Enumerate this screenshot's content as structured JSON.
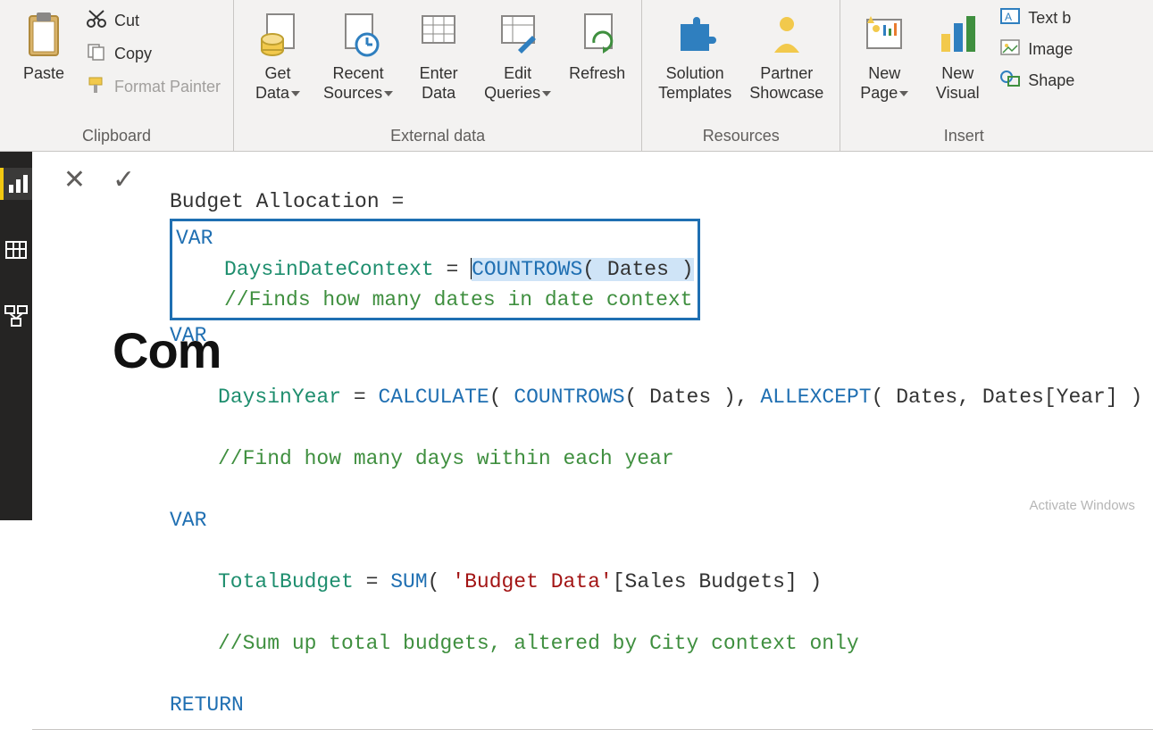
{
  "ribbon": {
    "clipboard": {
      "label": "Clipboard",
      "paste": "Paste",
      "cut": "Cut",
      "copy": "Copy",
      "format_painter": "Format Painter"
    },
    "external": {
      "label": "External data",
      "get_data": "Get\nData",
      "recent_sources": "Recent\nSources",
      "enter_data": "Enter\nData",
      "edit_queries": "Edit\nQueries",
      "refresh": "Refresh"
    },
    "resources": {
      "label": "Resources",
      "solution_templates": "Solution\nTemplates",
      "partner_showcase": "Partner\nShowcase"
    },
    "insert": {
      "label": "Insert",
      "new_page": "New\nPage",
      "new_visual": "New\nVisual",
      "text_box": "Text b",
      "image": "Image",
      "shapes": "Shape"
    }
  },
  "formula": {
    "line1_name": "Budget Allocation",
    "line1_eq": " = ",
    "var_kw": "VAR",
    "return_kw": "RETURN",
    "v1_name": "DaysinDateContext",
    "v1_eq": " = ",
    "v1_fn": "COUNTROWS",
    "v1_args": "( Dates )",
    "v1_comment": "//Finds how many dates in date context",
    "v2_prefix": "D",
    "v2_name": "aysinYear",
    "v2_eq": " = ",
    "v2_fn1": "CALCULATE",
    "v2_p1": "( ",
    "v2_fn2": "COUNTROWS",
    "v2_p2": "( Dates ), ",
    "v2_fn3": "ALLEXCEPT",
    "v2_p3": "( Dates, Dates[Year] ) )",
    "v2_comment": "//Find how many days within each year",
    "v3_name": "TotalBudget",
    "v3_eq": " = ",
    "v3_fn": "SUM",
    "v3_p1": "( ",
    "v3_str": "'Budget Data'",
    "v3_col": "[Sales Budgets] )",
    "v3_comment": "//Sum up total budgets, altered by City context only"
  },
  "canvas": {
    "title_fragment": "Com"
  },
  "watermark": "Activate Windows"
}
